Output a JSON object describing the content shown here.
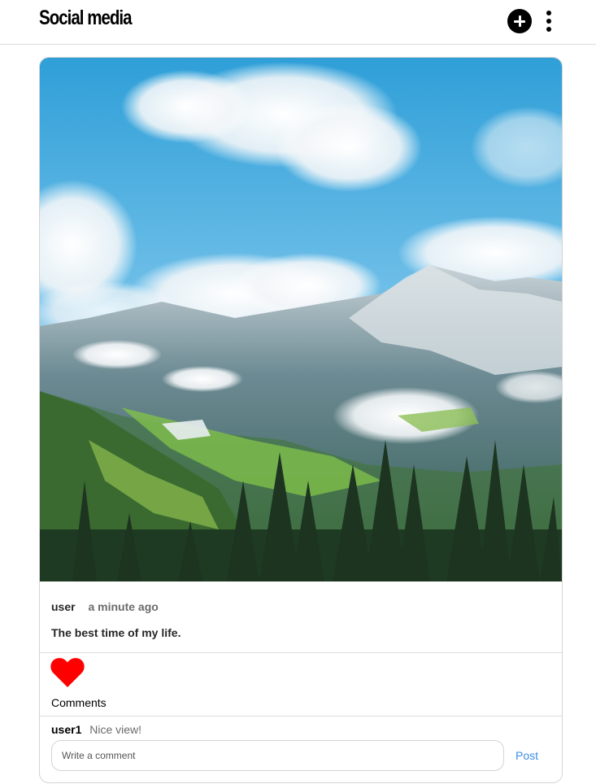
{
  "header": {
    "title": "Social media",
    "add_icon": "plus-circle-icon",
    "more_icon": "more-vertical-icon"
  },
  "post": {
    "image": "mountain-landscape-photo",
    "username": "user",
    "timestamp": "a minute ago",
    "caption": "The best time of my life.",
    "like_icon": "heart-icon",
    "like_color": "#ff0000",
    "liked": true
  },
  "comments": {
    "title": "Comments",
    "items": [
      {
        "user": "user1",
        "text": "Nice view!"
      }
    ],
    "input_placeholder": "Write a comment",
    "post_label": "Post",
    "post_color": "#3b8ee8"
  }
}
